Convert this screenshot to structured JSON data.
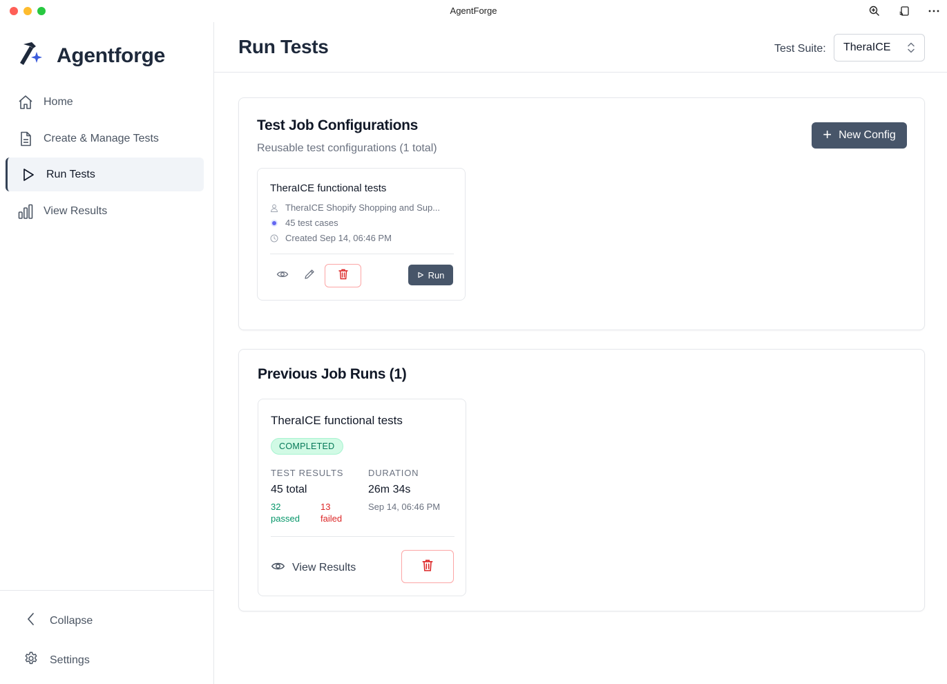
{
  "window": {
    "title": "AgentForge"
  },
  "brand": {
    "name": "Agentforge"
  },
  "sidebar": {
    "items": [
      {
        "label": "Home",
        "icon": "home-icon"
      },
      {
        "label": "Create & Manage Tests",
        "icon": "document-icon"
      },
      {
        "label": "Run Tests",
        "icon": "play-icon",
        "active": true
      },
      {
        "label": "View Results",
        "icon": "bar-chart-icon"
      }
    ],
    "collapse_label": "Collapse",
    "settings_label": "Settings"
  },
  "header": {
    "title": "Run Tests",
    "suite_label": "Test Suite:",
    "suite_value": "TheraICE"
  },
  "configs": {
    "title": "Test Job Configurations",
    "subtitle": "Reusable test configurations (1 total)",
    "new_button": "New Config",
    "cards": [
      {
        "title": "TheraICE functional tests",
        "agent": "TheraICE Shopify Shopping and Sup...",
        "cases": "45 test cases",
        "created": "Created Sep 14, 06:46 PM",
        "run_label": "Run"
      }
    ]
  },
  "runs": {
    "title": "Previous Job Runs (1)",
    "cards": [
      {
        "title": "TheraICE functional tests",
        "status": "COMPLETED",
        "results_label": "TEST RESULTS",
        "total": "45 total",
        "passed_count": "32",
        "passed_word": "passed",
        "failed_count": "13",
        "failed_word": "failed",
        "duration_label": "DURATION",
        "duration": "26m 34s",
        "date": "Sep 14, 06:46 PM",
        "view_label": "View Results"
      }
    ]
  },
  "colors": {
    "accent": "#475569",
    "success_bg": "#d1fae5",
    "success_text": "#047857",
    "danger": "#dc2626",
    "dot": "#6366f1"
  }
}
